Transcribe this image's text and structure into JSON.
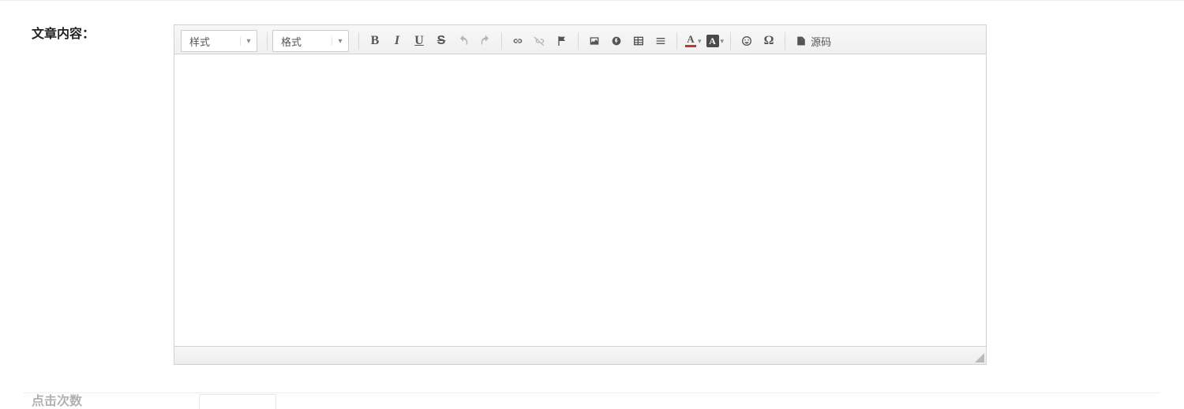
{
  "form": {
    "content_label": "文章内容：",
    "next_label": "点击次数"
  },
  "editor": {
    "combos": {
      "style": "样式",
      "format": "格式"
    },
    "source_label": "源码",
    "content": ""
  }
}
